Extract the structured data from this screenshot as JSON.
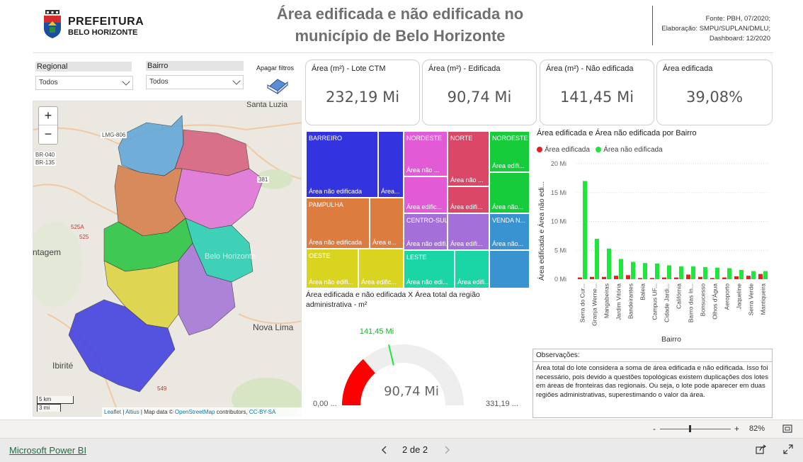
{
  "header": {
    "logo_line1": "PREFEITURA",
    "logo_line2": "BELO HORIZONTE",
    "title_line1": "Área edificada e não edificada no",
    "title_line2": "município de Belo Horizonte",
    "source": "Fonte: PBH, 07/2020;",
    "elaboration": "Elaboração: SMPU/SUPLAN/DMLU;",
    "dashboard": "Dashboard: 12/2020"
  },
  "filters": {
    "regional_label": "Regional",
    "regional_value": "Todos",
    "bairro_label": "Bairro",
    "bairro_value": "Todos",
    "clear_label": "Apagar filtros"
  },
  "map": {
    "zoom_in": "+",
    "zoom_out": "−",
    "place_labels": [
      "Santa Luzia",
      "LMG-806",
      "BR-040",
      "BR-135",
      "ntagem",
      "Nova Lima",
      "Ibirité",
      "381",
      "525A",
      "525",
      "549"
    ],
    "scale_km": "5 km",
    "scale_mi": "3 mi",
    "attribution_leaflet": "Leaflet",
    "attribution_altius": "Altius",
    "attribution_mid": " | Map data © ",
    "attribution_osm": "OpenStreetMap",
    "attribution_contrib": " contributors, ",
    "attribution_license": "CC-BY-SA"
  },
  "kpis": [
    {
      "label": "Área (m²) - Lote CTM",
      "value": "232,19 Mi"
    },
    {
      "label": "Área (m²) - Edificada",
      "value": "90,74 Mi"
    },
    {
      "label": "Área (m²) - Não edificada",
      "value": "141,45 Mi"
    },
    {
      "label": "Área edificada",
      "value": "39,08%"
    }
  ],
  "treemap": {
    "barreiro": {
      "name": "BARREIRO",
      "a": "Área não edificada",
      "b": "Área..."
    },
    "pampulha": {
      "name": "PAMPULHA",
      "a": "Área não edificada",
      "b": "Área e..."
    },
    "oeste": {
      "name": "OESTE",
      "a": "Área não edifi...",
      "b": "Área edific..."
    },
    "nordeste": {
      "name": "NORDESTE",
      "a": "Área não ...",
      "b": "Área edific..."
    },
    "norte": {
      "name": "NORTE",
      "a": "Área não ...",
      "b": "Área edifi..."
    },
    "noroeste": {
      "name": "NOROESTE",
      "a": "Área edifi...",
      "b": "Área não..."
    },
    "centro_sul": {
      "name": "CENTRO-SUL",
      "a": "Área não edifi...",
      "b": "Área edifi..."
    },
    "venda_nova": {
      "name": "VENDA N...",
      "a": "Área não..."
    },
    "leste": {
      "name": "LESTE",
      "a": "Área não edi...",
      "b": "Área edifi..."
    },
    "colors": {
      "barreiro": "#3433e0",
      "pampulha": "#dc7c3f",
      "oeste": "#d9d41f",
      "nordeste": "#e35ad6",
      "norte": "#da4767",
      "noroeste": "#16cc3b",
      "centro_sul": "#a56fd9",
      "venda_nova": "#3a93d1",
      "leste": "#1ad6a5"
    }
  },
  "chart_data": {
    "type": "bar",
    "title": "Área edificada e Área não edificada por Bairro",
    "xlabel": "Bairro",
    "ylabel": "Área edificada e Área não edi...",
    "ylim": [
      0,
      20
    ],
    "yticks": [
      "0 Mi",
      "5 Mi",
      "10 Mi",
      "15 Mi",
      "20 Mi"
    ],
    "categories": [
      "Serra do Cur...",
      "Granja Werne...",
      "Mangabeiras",
      "Jardim Vitória",
      "Bandeirantes",
      "Baleia",
      "Campus UF...",
      "Cidade Jardi...",
      "Califórnia",
      "Bairro das In...",
      "Bonsucesso",
      "Olhos d'Água",
      "Aeroporto",
      "Jaqueline",
      "Serra Verde",
      "Mantiqueira"
    ],
    "series": [
      {
        "name": "Área edificada",
        "color": "#e62020",
        "values": [
          0.3,
          0.4,
          0.4,
          0.6,
          0.7,
          0.2,
          0.2,
          0.3,
          0.3,
          0.8,
          0.4,
          0.2,
          0.3,
          0.5,
          0.6,
          0.9
        ]
      },
      {
        "name": "Área não edificada",
        "color": "#1ee63a",
        "values": [
          17.0,
          7.0,
          5.3,
          3.5,
          3.0,
          2.8,
          2.7,
          2.4,
          2.2,
          2.2,
          2.1,
          2.0,
          1.9,
          1.6,
          1.4,
          1.4
        ]
      }
    ],
    "legend_position": "top-left"
  },
  "gauge": {
    "title": "Área edificada e não edificada X Área total da região administrativa - m²",
    "value_label": "90,74 Mi",
    "target_label": "141,45 Mi",
    "min_label": "0,00 ...",
    "max_label": "331,19 ...",
    "value": 90.74,
    "target": 141.45,
    "max": 331.19,
    "fill_color": "#ff0000",
    "target_color": "#1ee63a"
  },
  "observations": {
    "title": "Observações:",
    "text": "Área total do lote considera a soma de área edificada e não edificada. Isso foi necessário, pois devido a questões topológicas existem duplicações dos lotes em áreas de fronteiras das regionais. Ou seja, o lote pode aparecer em duas regiões administrativas, superestimando o valor da área."
  },
  "statusbar": {
    "zoom_minus": "-",
    "zoom_plus": "+",
    "zoom_level": "82%",
    "zoom_fraction": 0.41
  },
  "footer": {
    "brand": "Microsoft Power BI",
    "page_indicator": "2 de 2"
  }
}
